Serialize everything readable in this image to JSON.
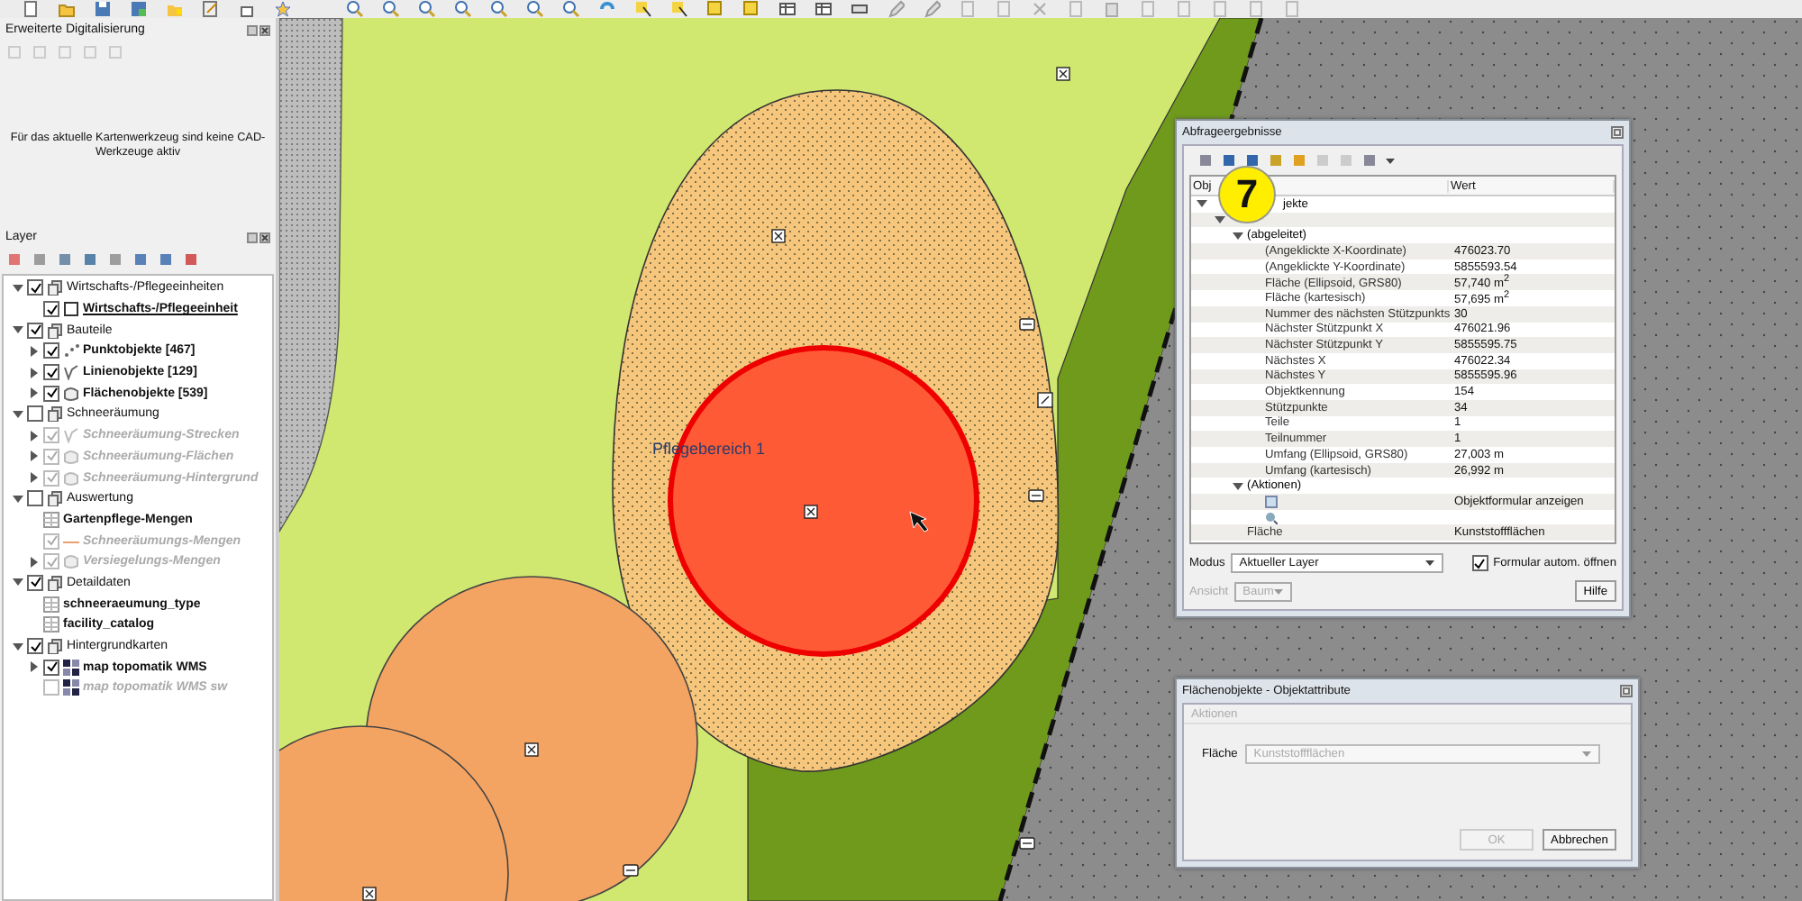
{
  "digitizing_panel": {
    "title": "Erweiterte Digitalisierung",
    "message": "Für das aktuelle Kartenwerkzeug sind keine CAD-Werkzeuge aktiv"
  },
  "layer_panel": {
    "title": "Layer",
    "tree": [
      {
        "kind": "group",
        "label": "Wirtschafts-/Pflegeeinheiten",
        "checked": true,
        "expanded": true,
        "disabled": false,
        "selected": false,
        "children": [
          {
            "kind": "polygon",
            "label": "Wirtschafts-/Pflegeeinheit",
            "checked": true,
            "disabled": false,
            "selected": true
          }
        ]
      },
      {
        "kind": "group",
        "label": "Bauteile",
        "checked": true,
        "expanded": true,
        "disabled": false,
        "selected": false,
        "children": [
          {
            "kind": "point",
            "label": "Punktobjekte [467]",
            "checked": true,
            "expanded": false,
            "disabled": false,
            "selected": false
          },
          {
            "kind": "line",
            "label": "Linienobjekte [129]",
            "checked": true,
            "expanded": false,
            "disabled": false,
            "selected": false
          },
          {
            "kind": "area",
            "label": "Flächenobjekte [539]",
            "checked": true,
            "expanded": false,
            "disabled": false,
            "selected": false
          }
        ]
      },
      {
        "kind": "group",
        "label": "Schneeräumung",
        "checked": false,
        "expanded": true,
        "disabled": false,
        "selected": false,
        "children": [
          {
            "kind": "line",
            "label": "Schneeräumung-Strecken",
            "checked": true,
            "expanded": false,
            "disabled": true,
            "selected": false
          },
          {
            "kind": "area",
            "label": "Schneeräumung-Flächen",
            "checked": true,
            "expanded": false,
            "disabled": true,
            "selected": false
          },
          {
            "kind": "area",
            "label": "Schneeräumung-Hintergrund",
            "checked": true,
            "expanded": false,
            "disabled": true,
            "selected": false
          }
        ]
      },
      {
        "kind": "group",
        "label": "Auswertung",
        "checked": false,
        "expanded": true,
        "disabled": false,
        "selected": false,
        "children": [
          {
            "kind": "table",
            "label": "Gartenpflege-Mengen",
            "disabled": false,
            "selected": false
          },
          {
            "kind": "dash",
            "label": "Schneeräumungs-Mengen",
            "checked": true,
            "disabled": true,
            "selected": false
          },
          {
            "kind": "area",
            "label": "Versiegelungs-Mengen",
            "checked": true,
            "expanded": false,
            "disabled": true,
            "selected": false
          }
        ]
      },
      {
        "kind": "group",
        "label": "Detaildaten",
        "checked": true,
        "expanded": true,
        "disabled": false,
        "selected": false,
        "children": [
          {
            "kind": "table",
            "label": "schneeraeumung_type",
            "disabled": false,
            "selected": false
          },
          {
            "kind": "table",
            "label": "facility_catalog",
            "disabled": false,
            "selected": false
          }
        ]
      },
      {
        "kind": "group",
        "label": "Hintergrundkarten",
        "checked": true,
        "expanded": true,
        "disabled": false,
        "selected": false,
        "children": [
          {
            "kind": "raster",
            "label": "map topomatik WMS",
            "checked": true,
            "expanded": false,
            "disabled": false,
            "selected": false
          },
          {
            "kind": "raster",
            "label": "map topomatik WMS sw",
            "checked": false,
            "disabled": true,
            "selected": false
          }
        ]
      }
    ]
  },
  "map": {
    "labels": [
      "Pflegebereich 1"
    ]
  },
  "badge": {
    "text": "7"
  },
  "query_dialog": {
    "title": "Abfrageergebnisse",
    "columns": [
      "Obj",
      "Wert"
    ],
    "tree": [
      {
        "kind": "group",
        "label": "jekte",
        "expanded": true,
        "children": [
          {
            "kind": "feature",
            "expanded": true,
            "children": [
              {
                "kind": "group",
                "label": "(abgeleitet)",
                "expanded": true,
                "children": [
                  {
                    "kind": "attribute",
                    "label": "(Angeklickte X-Koordinate)",
                    "value": "476023.70"
                  },
                  {
                    "kind": "attribute",
                    "label": "(Angeklickte Y-Koordinate)",
                    "value": "5855593.54"
                  },
                  {
                    "kind": "attribute",
                    "label": "Fläche (Ellipsoid, GRS80)",
                    "value": "57,740 m$^{2}$"
                  },
                  {
                    "kind": "attribute",
                    "label": "Fläche (kartesisch)",
                    "value": "57,695 m$^{2}$"
                  },
                  {
                    "kind": "attribute",
                    "label": "Nummer des nächsten Stützpunkts",
                    "value": "30"
                  },
                  {
                    "kind": "attribute",
                    "label": "Nächster Stützpunkt X",
                    "value": "476021.96"
                  },
                  {
                    "kind": "attribute",
                    "label": "Nächster Stützpunkt Y",
                    "value": "5855595.75"
                  },
                  {
                    "kind": "attribute",
                    "label": "Nächstes X",
                    "value": "476022.34"
                  },
                  {
                    "kind": "attribute",
                    "label": "Nächstes Y",
                    "value": "5855595.96"
                  },
                  {
                    "kind": "attribute",
                    "label": "Objektkennung",
                    "value": "154"
                  },
                  {
                    "kind": "attribute",
                    "label": "Stützpunkte",
                    "value": "34"
                  },
                  {
                    "kind": "attribute",
                    "label": "Teile",
                    "value": "1"
                  },
                  {
                    "kind": "attribute",
                    "label": "Teilnummer",
                    "value": "1"
                  },
                  {
                    "kind": "attribute",
                    "label": "Umfang (Ellipsoid, GRS80)",
                    "value": "27,003 m"
                  },
                  {
                    "kind": "attribute",
                    "label": "Umfang (kartesisch)",
                    "value": "26,992 m"
                  }
                ]
              },
              {
                "kind": "group",
                "label": "(Aktionen)",
                "expanded": true,
                "children": [
                  {
                    "kind": "action",
                    "value": "Objektformular anzeigen"
                  },
                  {
                    "kind": "action"
                  }
                ]
              },
              {
                "kind": "attribute",
                "label": "Fläche",
                "value": "Kunststoffflächen"
              }
            ]
          }
        ]
      }
    ],
    "mode_label": "Modus",
    "mode_value": "Aktueller Layer",
    "auto_open": {
      "label": "Formular autom. öffnen",
      "checked": true
    },
    "view_label": "Ansicht",
    "view_value": "Baum",
    "view_disabled": true,
    "help_button": "Hilfe"
  },
  "attribute_dialog": {
    "title": "Flächenobjekte - Objektattribute",
    "menu": [
      {
        "label": "Aktionen",
        "disabled": true
      }
    ],
    "fields": [
      {
        "label": "Fläche",
        "value": "Kunststoffflächen",
        "disabled": true
      }
    ],
    "buttons": [
      {
        "label": "OK",
        "disabled": true
      },
      {
        "label": "Abbrechen",
        "disabled": false
      }
    ]
  }
}
